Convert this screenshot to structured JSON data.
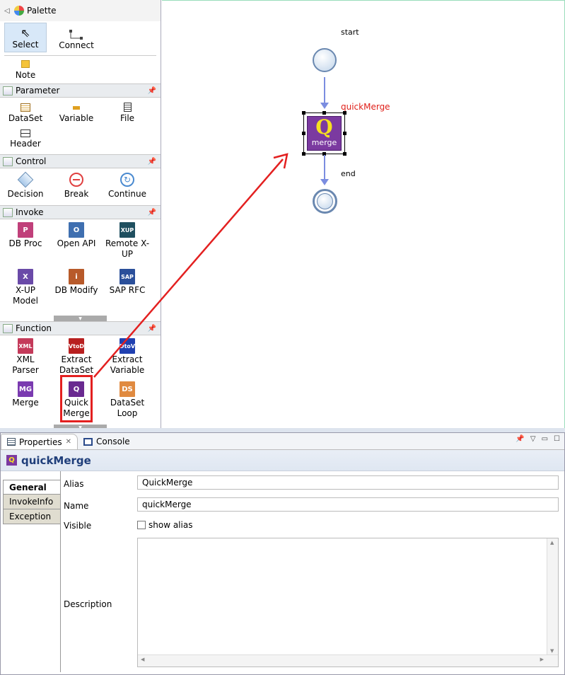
{
  "palette": {
    "title": "Palette",
    "tools": [
      {
        "label": "Select"
      },
      {
        "label": "Connect"
      },
      {
        "label": "Note"
      }
    ],
    "categories": [
      {
        "name": "Parameter",
        "items": [
          {
            "label": "DataSet",
            "icon": "dataset-icon"
          },
          {
            "label": "Variable",
            "icon": "variable-icon"
          },
          {
            "label": "File",
            "icon": "file-icon"
          },
          {
            "label": "Header",
            "icon": "header-icon"
          }
        ]
      },
      {
        "name": "Control",
        "items": [
          {
            "label": "Decision",
            "icon": "decision-icon"
          },
          {
            "label": "Break",
            "icon": "break-icon"
          },
          {
            "label": "Continue",
            "icon": "continue-icon"
          }
        ]
      },
      {
        "name": "Invoke",
        "items": [
          {
            "label": "DB Proc",
            "icon": "db-proc-icon",
            "glyph": "P",
            "color": "#c0407a"
          },
          {
            "label": "Open API",
            "icon": "open-api-icon",
            "glyph": "O",
            "color": "#3f6fb0"
          },
          {
            "label": "Remote X-UP",
            "icon": "remote-xup-icon",
            "glyph": "XUP",
            "color": "#1f4f5f"
          },
          {
            "label": "X-UP Model",
            "icon": "xup-model-icon",
            "glyph": "X",
            "color": "#6a4aa8"
          },
          {
            "label": "DB Modify",
            "icon": "db-modify-icon",
            "glyph": "i",
            "color": "#b85a2a"
          },
          {
            "label": "SAP RFC",
            "icon": "sap-rfc-icon",
            "glyph": "SAP",
            "color": "#2a4f9a"
          }
        ]
      },
      {
        "name": "Function",
        "items": [
          {
            "label": "XML Parser",
            "icon": "xml-parser-icon",
            "glyph": "XML",
            "color": "#c43a5a"
          },
          {
            "label": "Extract DataSet",
            "icon": "extract-dataset-icon",
            "glyph": "VtoD",
            "color": "#b82020"
          },
          {
            "label": "Extract Variable",
            "icon": "extract-variable-icon",
            "glyph": "DtoV",
            "color": "#2040b0"
          },
          {
            "label": "Merge",
            "icon": "merge-icon",
            "glyph": "MG",
            "color": "#7a3ab0"
          },
          {
            "label": "Quick Merge",
            "icon": "quick-merge-icon",
            "glyph": "Q",
            "color": "#6a2a90"
          },
          {
            "label": "DataSet Loop",
            "icon": "dataset-loop-icon",
            "glyph": "DS",
            "color": "#e08a40"
          }
        ]
      }
    ]
  },
  "canvas": {
    "start_label": "start",
    "node_label": "quickMerge",
    "node_glyph": "Q",
    "node_text": "merge",
    "end_label": "end"
  },
  "properties": {
    "tabs": [
      {
        "label": "Properties"
      },
      {
        "label": "Console"
      }
    ],
    "title": "quickMerge",
    "side_tabs": [
      "General",
      "InvokeInfo",
      "Exception"
    ],
    "fields": {
      "alias_label": "Alias",
      "alias_value": "QuickMerge",
      "name_label": "Name",
      "name_value": "quickMerge",
      "visible_label": "Visible",
      "visible_checkbox": "show alias",
      "description_label": "Description",
      "description_value": ""
    }
  },
  "colors": {
    "node_fill": "#7b3aa0",
    "node_label": "#e0201a",
    "annotation_red": "#e32020",
    "connector": "#7b8de0"
  }
}
